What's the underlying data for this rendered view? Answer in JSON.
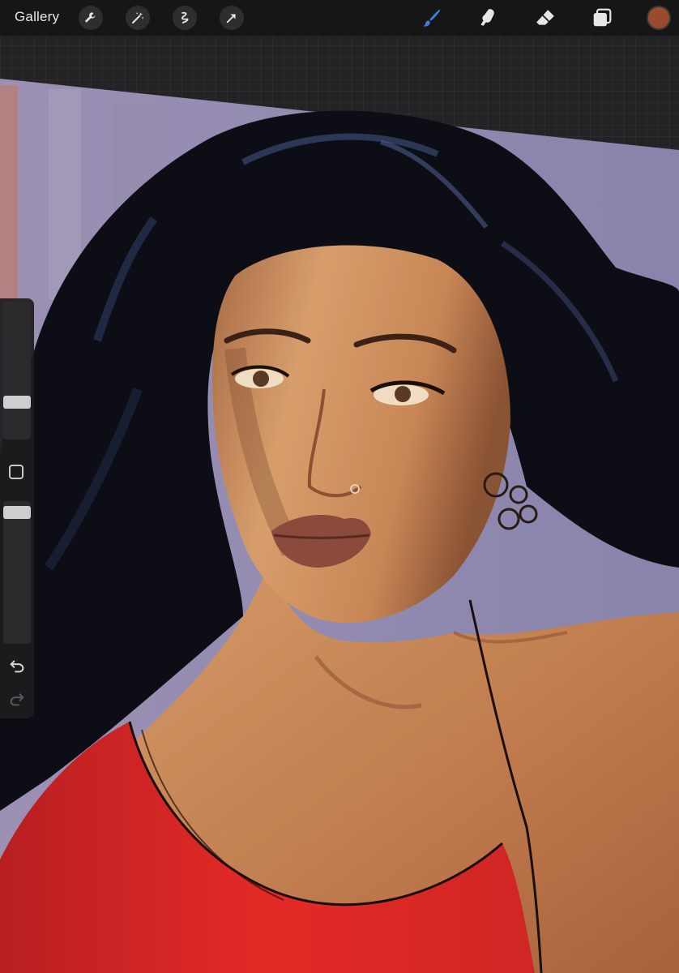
{
  "toolbar": {
    "gallery_label": "Gallery",
    "left_tools": [
      {
        "icon": "wrench-icon",
        "name": "actions"
      },
      {
        "icon": "magic-wand-icon",
        "name": "adjustments"
      },
      {
        "icon": "selection-icon",
        "name": "selection"
      },
      {
        "icon": "transform-arrow-icon",
        "name": "transform"
      }
    ],
    "right_tools": [
      {
        "icon": "brush-icon",
        "name": "paint",
        "active": true
      },
      {
        "icon": "smudge-icon",
        "name": "smudge",
        "active": false
      },
      {
        "icon": "eraser-icon",
        "name": "erase",
        "active": false
      },
      {
        "icon": "layers-icon",
        "name": "layers",
        "active": false
      }
    ],
    "current_color": "#9a4a2e",
    "active_tool_color": "#3f7be6",
    "inactive_tool_color": "#e6e6e6"
  },
  "sidebar": {
    "brush_size_level": 0.75,
    "opacity_level": 0.04,
    "modify_button_icon": "square-icon",
    "undo_icon": "undo-icon",
    "redo_icon": "redo-icon"
  },
  "canvas": {
    "background_color": "#8f8aa8",
    "hair_color": "#0c0c14",
    "skin_color": "#c98a5a",
    "garment_color": "#d92a28"
  }
}
